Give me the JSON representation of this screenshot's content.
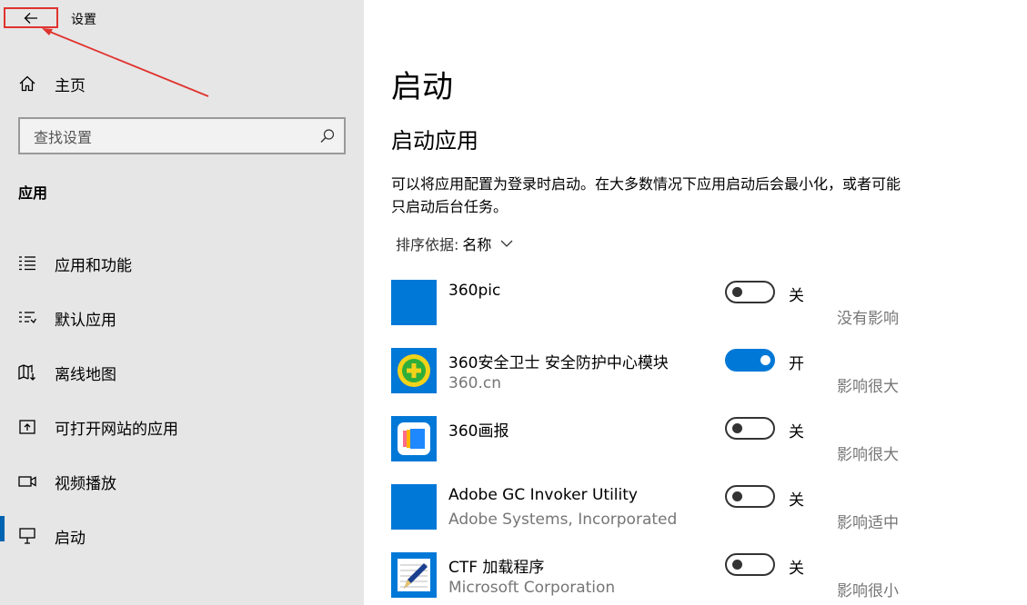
{
  "window": {
    "title": "设置"
  },
  "sidebar": {
    "home_label": "主页",
    "search_placeholder": "查找设置",
    "section_title": "应用",
    "items": [
      {
        "label": "应用和功能",
        "icon": "list-icon",
        "active": false
      },
      {
        "label": "默认应用",
        "icon": "default-apps-icon",
        "active": false
      },
      {
        "label": "离线地图",
        "icon": "map-download-icon",
        "active": false
      },
      {
        "label": "可打开网站的应用",
        "icon": "open-website-icon",
        "active": false
      },
      {
        "label": "视频播放",
        "icon": "video-icon",
        "active": false
      },
      {
        "label": "启动",
        "icon": "startup-icon",
        "active": true
      }
    ]
  },
  "main": {
    "title": "启动",
    "subtitle": "启动应用",
    "description": "可以将应用配置为登录时启动。在大多数情况下应用启动后会最小化，或者可能只启动后台任务。",
    "sort_label": "排序依据:",
    "sort_value": "名称",
    "apps": [
      {
        "name": "360pic",
        "publisher": "",
        "state": "关",
        "impact": "没有影响",
        "enabled": false,
        "icon": "blue-square-icon"
      },
      {
        "name": "360安全卫士 安全防护中心模块",
        "publisher": "360.cn",
        "state": "开",
        "impact": "影响很大",
        "enabled": true,
        "icon": "360-safe-icon"
      },
      {
        "name": "360画报",
        "publisher": "",
        "state": "关",
        "impact": "影响很大",
        "enabled": false,
        "icon": "360-pictorial-icon"
      },
      {
        "name": "Adobe GC Invoker Utility",
        "publisher": "Adobe Systems, Incorporated",
        "state": "关",
        "impact": "影响适中",
        "enabled": false,
        "icon": "blue-square-icon"
      },
      {
        "name": "CTF 加载程序",
        "publisher": "Microsoft Corporation",
        "state": "关",
        "impact": "影响很小",
        "enabled": false,
        "icon": "ctf-loader-icon"
      }
    ]
  },
  "colors": {
    "accent": "#0078d7",
    "annotation": "#e0332f",
    "sidebar_bg": "#e6e6e6"
  }
}
